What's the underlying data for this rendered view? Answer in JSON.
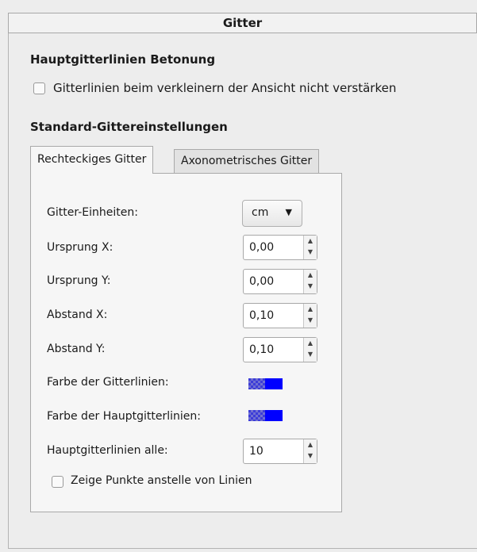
{
  "panel": {
    "title": "Gitter"
  },
  "major_emphasis": {
    "heading": "Hauptgitterlinien Betonung",
    "checkbox_label": "Gitterlinien beim verkleinern der Ansicht nicht verstärken",
    "checked": false
  },
  "defaults": {
    "heading": "Standard-Gittereinstellungen",
    "tabs": [
      "Rechteckiges Gitter",
      "Axonometrisches Gitter"
    ],
    "active_tab": "Rechteckiges Gitter"
  },
  "rect": {
    "units_label": "Gitter-Einheiten:",
    "units_value": "cm",
    "origin_x_label": "Ursprung X:",
    "origin_x_value": "0,00",
    "origin_y_label": "Ursprung Y:",
    "origin_y_value": "0,00",
    "spacing_x_label": "Abstand X:",
    "spacing_x_value": "0,10",
    "spacing_y_label": "Abstand Y:",
    "spacing_y_value": "0,10",
    "grid_color_label": "Farbe der Gitterlinien:",
    "grid_color": "#0000ff",
    "major_color_label": "Farbe der Hauptgitterlinien:",
    "major_color": "#0000ff",
    "major_every_label": "Hauptgitterlinien alle:",
    "major_every_value": "10",
    "dots_label": "Zeige Punkte anstelle von Linien",
    "dots_checked": false
  },
  "icons": {
    "dropdown_arrow": "chevron-down-icon",
    "spin_up": "arrow-up-icon",
    "spin_down": "arrow-down-icon"
  }
}
